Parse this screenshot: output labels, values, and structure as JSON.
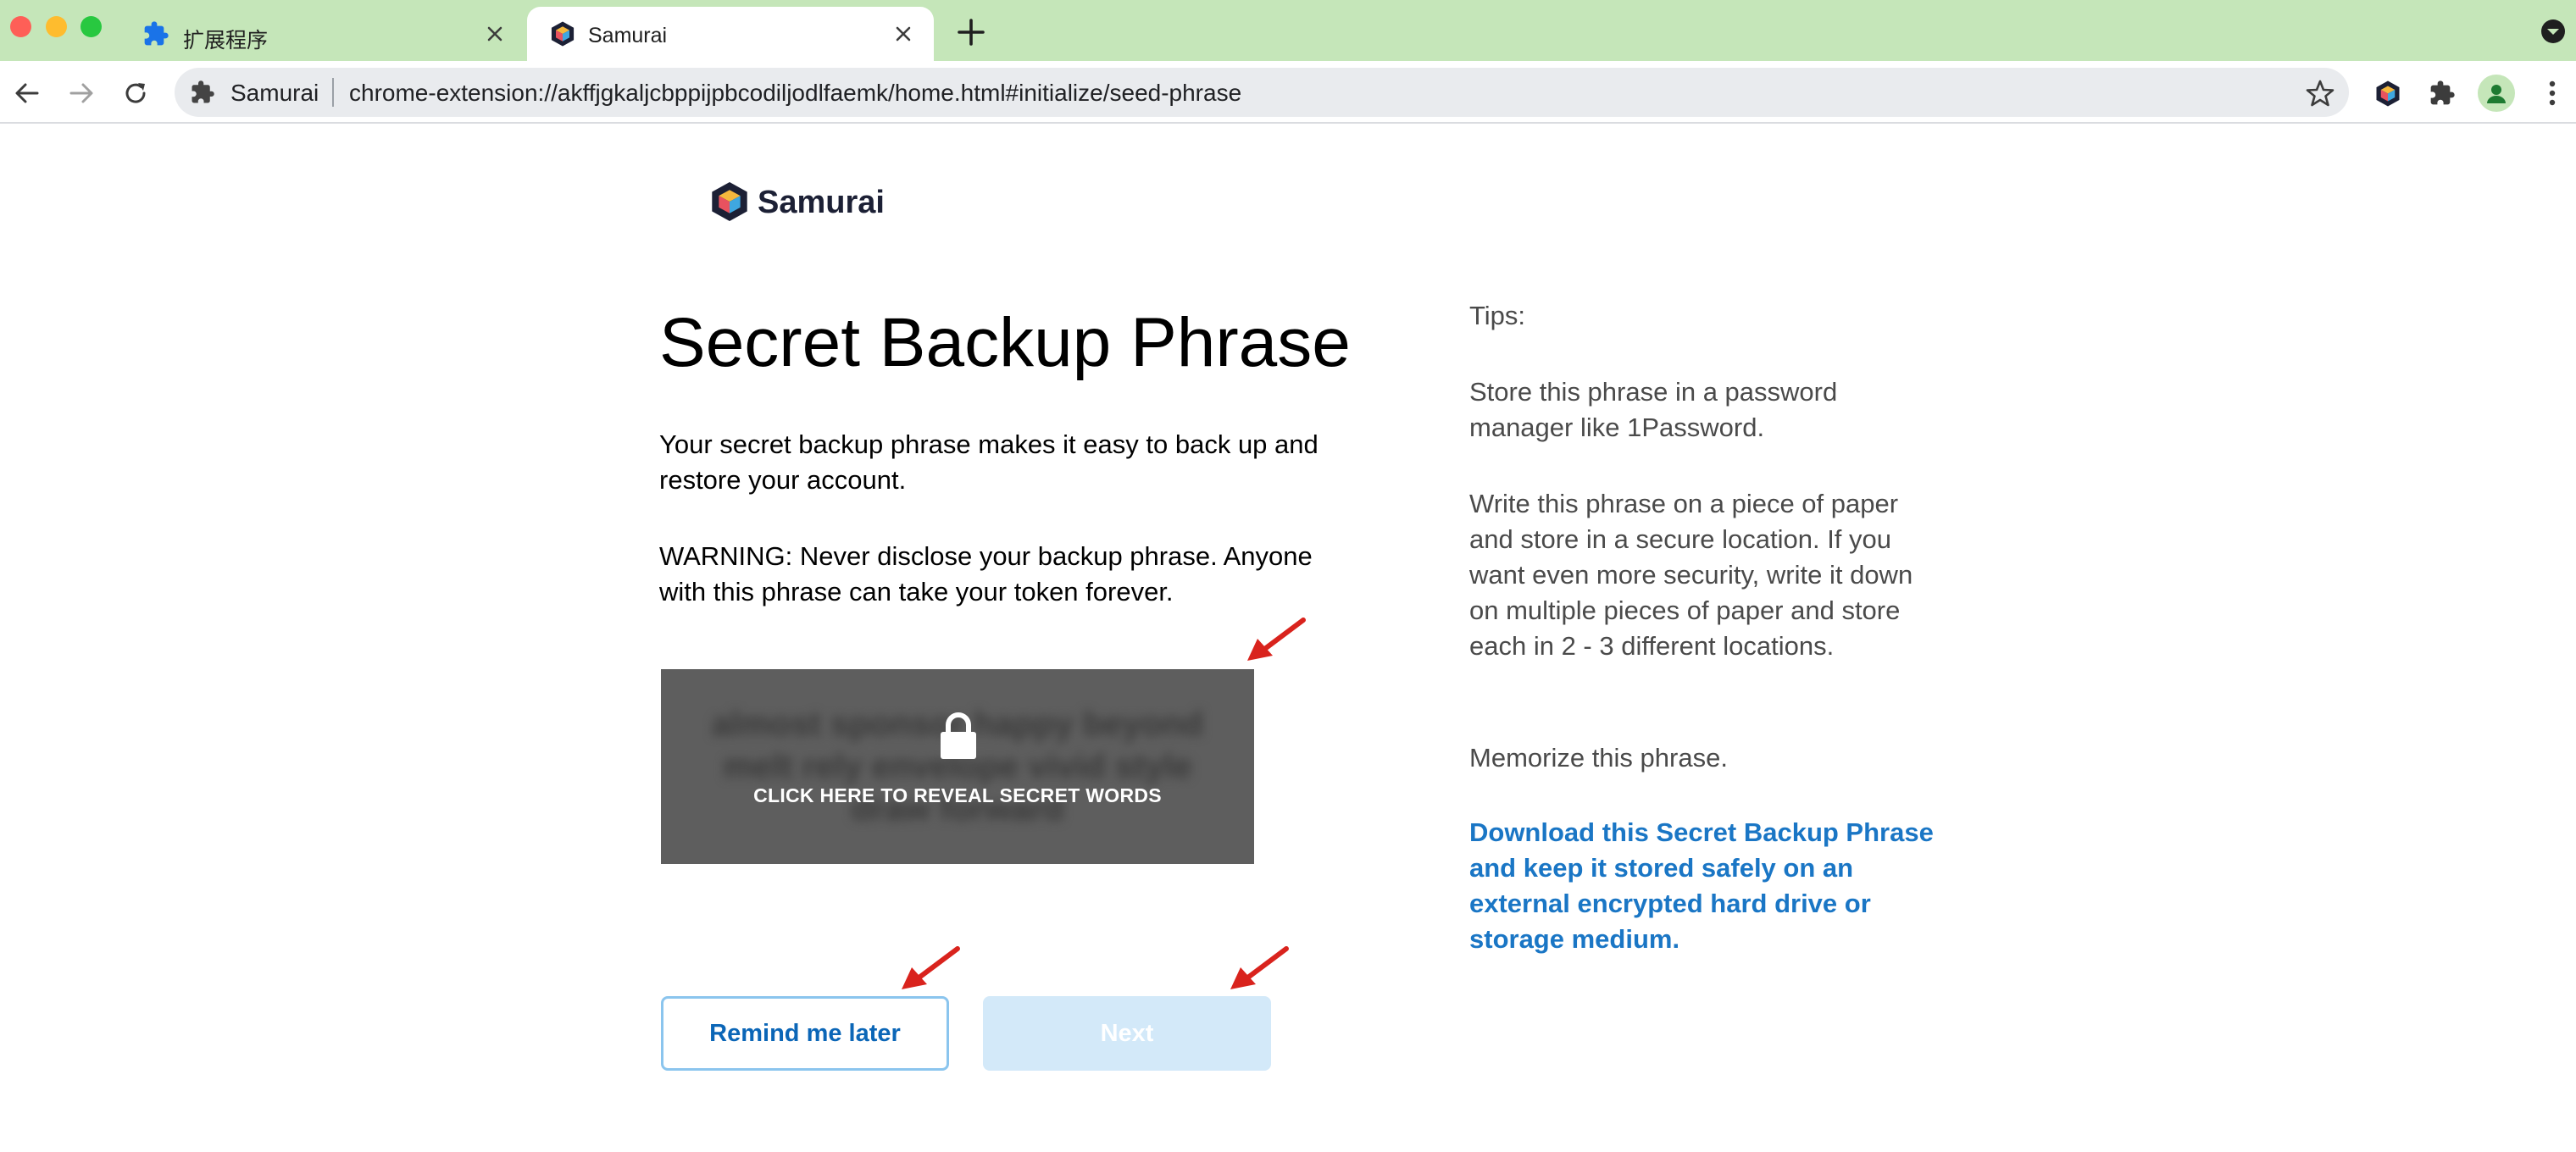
{
  "browser": {
    "tabs": [
      {
        "title": "扩展程序",
        "icon": "puzzle-icon",
        "active": false
      },
      {
        "title": "Samurai",
        "icon": "samurai-logo-icon",
        "active": true
      }
    ],
    "omnibox": {
      "site_name": "Samurai",
      "url": "chrome-extension://akffjgkaljcbppijpbcodiljodlfaemk/home.html#initialize/seed-phrase"
    },
    "colors": {
      "tabstrip": "#c5e6b9",
      "omnibox": "#e9ebee"
    }
  },
  "brand": {
    "name": "Samurai"
  },
  "page": {
    "title": "Secret Backup Phrase",
    "description": "Your secret backup phrase makes it easy to back up and restore your account.",
    "warning": "WARNING: Never disclose your backup phrase. Anyone with this phrase can take your token forever.",
    "reveal_label": "CLICK HERE TO REVEAL SECRET WORDS",
    "blurred_words": "almost sponsor happy beyond melt rely envelope vivid style draw forward"
  },
  "buttons": {
    "remind_later": "Remind me later",
    "next": "Next"
  },
  "tips": {
    "heading": "Tips:",
    "items": [
      "Store this phrase in a password manager like 1Password.",
      "Write this phrase on a piece of paper and store in a secure location. If you want even more security, write it down on multiple pieces of paper and store each in 2 - 3 different locations.",
      "Memorize this phrase."
    ],
    "download_link": "Download this Secret Backup Phrase and keep it stored safely on an external encrypted hard drive or storage medium."
  },
  "theme": {
    "primary_blue": "#0b66b7",
    "link_blue": "#1a76c5",
    "disabled_button": "#d3e9f9",
    "reveal_box": "#5e5e5e",
    "annotation_arrow": "#d9231d"
  }
}
